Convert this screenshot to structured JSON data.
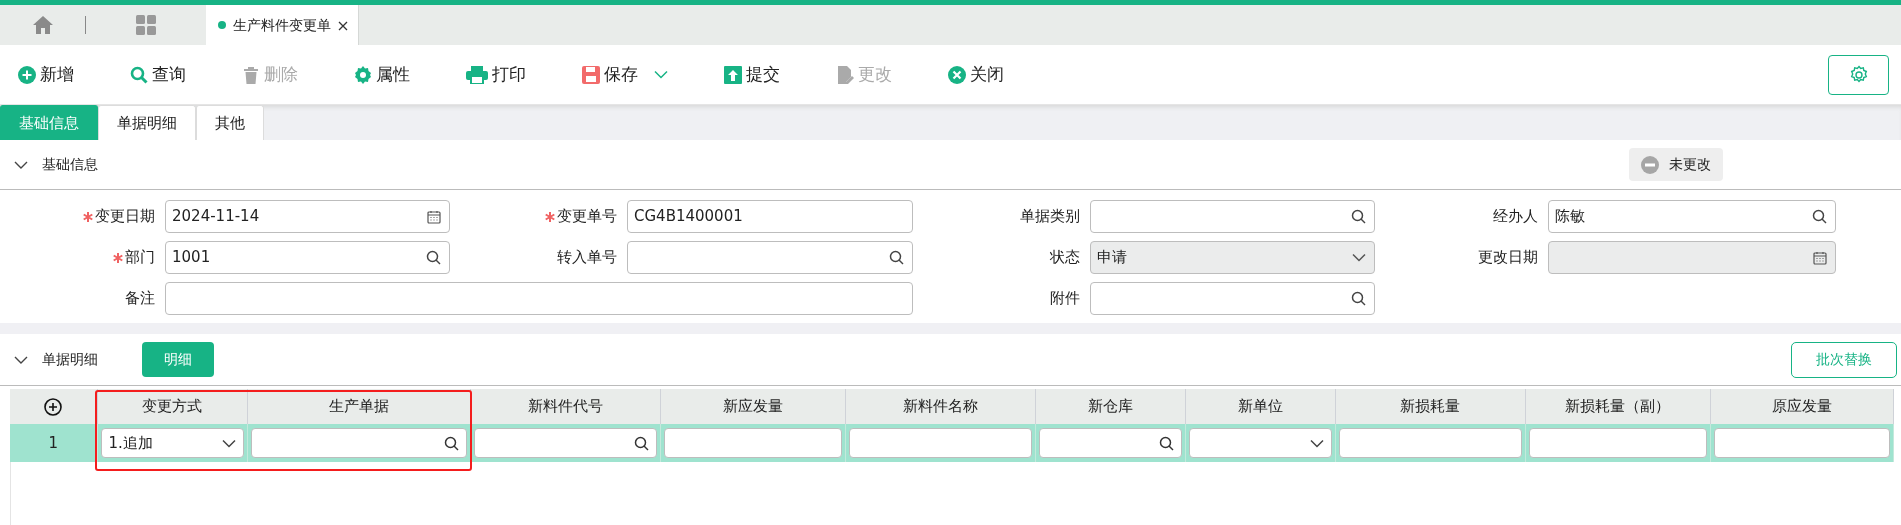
{
  "window_tab": {
    "title": "生产料件变更单",
    "selected": true
  },
  "toolbar": [
    {
      "kind": "add",
      "label": "新增",
      "disabled": false
    },
    {
      "kind": "search",
      "label": "查询",
      "disabled": false
    },
    {
      "kind": "delete",
      "label": "删除",
      "disabled": true
    },
    {
      "kind": "settings",
      "label": "属性",
      "disabled": false
    },
    {
      "kind": "print",
      "label": "打印",
      "disabled": false
    },
    {
      "kind": "save",
      "label": "保存",
      "disabled": false,
      "dropdown": true
    },
    {
      "kind": "submit",
      "label": "提交",
      "disabled": false
    },
    {
      "kind": "edit",
      "label": "更改",
      "disabled": true
    },
    {
      "kind": "close",
      "label": "关闭",
      "disabled": false
    }
  ],
  "section_tabs": [
    {
      "label": "基础信息",
      "selected": true
    },
    {
      "label": "单据明细",
      "selected": false
    },
    {
      "label": "其他",
      "selected": false
    }
  ],
  "basic_info": {
    "title": "基础信息",
    "expanded": true,
    "status_badge": "未更改",
    "fields": [
      {
        "label": "变更日期",
        "required": true,
        "kind": "date",
        "value": "2024-11-14",
        "disabled": false
      },
      {
        "label": "变更单号",
        "required": true,
        "kind": "text",
        "value": "CG4B1400001",
        "disabled": false
      },
      {
        "label": "单据类别",
        "required": false,
        "kind": "search",
        "disabled": false
      },
      {
        "label": "经办人",
        "required": false,
        "kind": "search",
        "value": "陈敏",
        "disabled": false
      },
      {
        "label": "部门",
        "required": true,
        "kind": "search",
        "value": "1001",
        "disabled": false
      },
      {
        "label": "转入单号",
        "required": false,
        "kind": "search",
        "disabled": false
      },
      {
        "label": "状态",
        "required": false,
        "kind": "select",
        "value": "申请",
        "disabled": true
      },
      {
        "label": "更改日期",
        "required": false,
        "kind": "date",
        "disabled": true
      },
      {
        "label": "备注",
        "required": false,
        "kind": "text",
        "disabled": false,
        "wide": true
      },
      {
        "label": "附件",
        "required": false,
        "kind": "search",
        "disabled": false
      }
    ]
  },
  "details": {
    "title": "单据明细",
    "expanded": true,
    "detail_button": "明细",
    "batch_button": "批次替换",
    "columns": [
      {
        "label": "变更方式",
        "highlighted": true
      },
      {
        "label": "生产单据",
        "highlighted": true
      },
      {
        "label": "新料件代号",
        "highlighted": false
      },
      {
        "label": "新应发量",
        "highlighted": false
      },
      {
        "label": "新料件名称",
        "highlighted": false
      },
      {
        "label": "新仓库",
        "highlighted": false
      },
      {
        "label": "新单位",
        "highlighted": false
      },
      {
        "label": "新损耗量",
        "highlighted": false
      },
      {
        "label": "新损耗量（副）",
        "highlighted": false
      },
      {
        "label": "原应发量",
        "highlighted": false
      }
    ],
    "rows": [
      {
        "number": "1",
        "selected": true,
        "cells": [
          {
            "kind": "select",
            "value": "1.追加"
          },
          {
            "kind": "search"
          },
          {
            "kind": "search"
          },
          {
            "kind": "text"
          },
          {
            "kind": "text"
          },
          {
            "kind": "search"
          },
          {
            "kind": "select"
          },
          {
            "kind": "text"
          },
          {
            "kind": "text"
          },
          {
            "kind": "text"
          }
        ]
      }
    ]
  }
}
